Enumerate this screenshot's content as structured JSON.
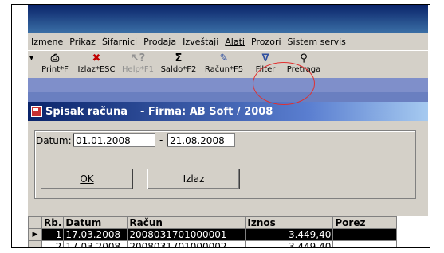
{
  "menu": [
    "Izmene",
    "Prikaz",
    "Šifarnici",
    "Prodaja",
    "Izveštaji",
    "Alati",
    "Prozori",
    "Sistem servis"
  ],
  "toolbar": [
    {
      "icon": "printer-icon",
      "glyph": "🖶",
      "label": "Print*F",
      "enabled": true
    },
    {
      "icon": "exit-icon",
      "glyph": "✖",
      "label": "Izlaz*ESC",
      "enabled": true
    },
    {
      "icon": "help-icon",
      "glyph": "?",
      "label": "Help*F1",
      "enabled": false
    },
    {
      "icon": "sigma-icon",
      "glyph": "Σ",
      "label": "Saldo*F2",
      "enabled": true
    },
    {
      "icon": "invoice-icon",
      "glyph": "✎",
      "label": "Račun*F5",
      "enabled": true
    },
    {
      "icon": "filter-icon",
      "glyph": "∇",
      "label": "Filter",
      "enabled": true
    },
    {
      "icon": "binoculars-icon",
      "glyph": "⚭",
      "label": "Pretraga",
      "enabled": true
    }
  ],
  "child_window": {
    "title": "Spisak računa",
    "subtitle": "- Firma:  AB Soft / 2008"
  },
  "filter": {
    "datum_label": "Datum:",
    "date_from": "01.01.2008",
    "dash": "-",
    "date_to": "21.08.2008",
    "ok_label": "OK",
    "izlaz_label": "Izlaz"
  },
  "grid": {
    "headers": [
      "Rb.",
      "Datum",
      "Račun",
      "Iznos",
      "Porez"
    ],
    "rows": [
      {
        "rb": "1",
        "datum": "17.03.2008",
        "racun": "2008031701000001",
        "iznos": "3.449,40",
        "porez": ""
      },
      {
        "rb": "2",
        "datum": "17.03.2008",
        "racun": "2008031701000002",
        "iznos": "3.449,40",
        "porez": ""
      }
    ]
  },
  "colors": {
    "annotation_circle": "#e03030",
    "selected_row": "#000000"
  }
}
